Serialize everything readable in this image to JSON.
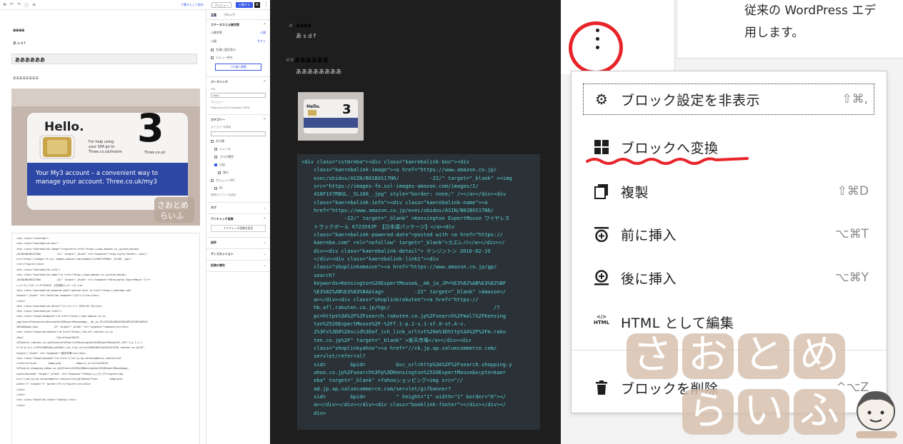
{
  "editor": {
    "topbar": {
      "draft_label": "下書きとして保存",
      "preview_label": "プレビュー",
      "publish_label": "公開する"
    },
    "content": {
      "heading": "aaaa",
      "paragraph1": "あ s d f",
      "heading2": "ああああああ",
      "paragraph2": "ああああああああ",
      "sim_card": {
        "brand": "Hello.",
        "sim_text": "For help using your SIM go to Three.co.uk/trosim",
        "site": "Three.co.uk",
        "banner": "Your My3 account – a convenient way to manage your account. Three.co.uk/my3",
        "watermark": "さおとめ らいふ"
      },
      "code_lines": [
        "<div class=\"cstmreba\">",
        "<div class=\"kaerebalink-box\">",
        "<div class=\"kaerebalink-image\"><figure><a href=\"https://www.amazon.co.jp/exec/obidos",
        "/ASIN/B01BXS17N6/          -22/\" target=\"_blank\" rel=\"noopener\"><img style=\"border: none;\"",
        "src=\"https://images-fe.ssl-images-amazon.com/images/I/418F1X7RBUL._SL160_.jpg\">",
        "</a></figure></div>",
        "<div class=\"kaerebalink-info\">",
        "<div class=\"kaerebalink-name\"><a href=\"https://www.amazon.co.jp/exec/obidos",
        "/ASIN/B01BXS17N6/          -22/\" target=\"_blank\" rel=\"noopener\">Kensington ExpertMouse ワイヤ",
        "レストラックボール K72359JP 【日本語パッケージ】</a>",
        "<div class=\"kaerebalink-powered-date\">posted with <a href=\"https://kaereba.com\"",
        "target=\"_blank\" rel=\"nofollow noopener\">カエレバ</a></div>",
        "</div>",
        "<div class=\"kaerebalink-detail\">ケンジントン 2016-02-19</div>",
        "<div class=\"kaerebalink-link1\">",
        "<div class=\"shoplinkamazon\"><a href=\"https://www.amazon.co.jp",
        "/gp/search?keywords=Kensington%20ExpertMouse&amp;__mk_ja_JP=%E3%82%AB%E3%82%BF%E3%82%AB%E3",
        "%83%8A&amp;tag=          -22\" target=\"_blank\" rel=\"noopener\">Amazon</a></div>",
        "<div class=\"shoplinkrakuten\"><a href=\"https://hb.afl.rakuten.co.jp",
        "/hgc/                      /?pc=https%3A%2F",
        "%2Fsearch.rakuten.co.jp%2Fsearch%2Fmall%2FKensington%2520ExpertMouse%2F-%2Ff.1-p.1-s.1-",
        "sf.0-st.A-v.2%3Fx%3D0%26scid%3Daf_ich_link_urltxt%26m%3Dhttp%3A%2F%2Fm.rakuten.co.jp%2F\"",
        "target=\"_blank\" rel=\"noopener\">楽天市場</a></div>",
        "<div class=\"shoplinkyahoo\"><a href=\"//ck.jp.ap.valuecommerce.com/servlet",
        "/referral?sid=        &amp;pid=          &amp;vc_url=http%3A%2F",
        "%2Fsearch.shopping.yahoo.co.jp%2Fsearch%3Fp%3DKensington%2520ExpertMouse&amp;",
        "vcptn=kaereba\" target=\"_blank\" rel=\"noopener\">Yahooショッピング<figure><img",
        "src=\"//ad.jp.ap.valuecommerce.com/servlet/gifbanner?sid=        &amp;pid=",
        "width=\"1\" height=\"1\" border=\"0\"></figure></a></div>",
        "</div>",
        "</div>",
        "<div class=\"booklink-footer\">&nbsp;</div>",
        "</div>"
      ]
    },
    "sidebar": {
      "tab_document": "文書",
      "tab_block": "ブロック",
      "status_section": "ステータスと公開状態",
      "visibility_label": "公開状態",
      "visibility_value": "公開",
      "publish_label": "公開",
      "publish_value": "今すぐ",
      "stick_label": "先頭に固定表示",
      "review_label": "レビュー待ち",
      "trash_button": "ゴミ箱へ移動",
      "permalink_section": "パーマリンク",
      "url_label": "URL",
      "url_value": "aaaa",
      "preview_label": "プレビュー",
      "preview_url": "https://jun1019.net/aaaa-7658/",
      "category_section": "カテゴリー",
      "category_search_placeholder": "カテゴリーを検索",
      "categories": [
        {
          "label": "未分類",
          "checked": false,
          "indent": 0
        },
        {
          "label": "ニュース",
          "checked": false,
          "indent": 1
        },
        {
          "label": "ブログ運営",
          "checked": false,
          "indent": 1
        },
        {
          "label": "日記",
          "checked": true,
          "indent": 1
        },
        {
          "label": "旅行",
          "checked": false,
          "indent": 2
        },
        {
          "label": "ガジェット/PC",
          "checked": false,
          "indent": 0
        },
        {
          "label": "PC",
          "checked": false,
          "indent": 1
        }
      ],
      "add_category": "新規カテゴリーを追加",
      "tag_section": "タグ",
      "eyecatch_section": "アイキャッチ画像",
      "eyecatch_button": "アイキャッチ画像を設定",
      "excerpt_section": "抜粋",
      "discussion_section": "ディスカッション",
      "attributes_section": "投稿の属性"
    }
  },
  "code_view": {
    "heading1": "aaaa",
    "para1": "あ s d f",
    "heading2": "ああああああ",
    "para2": "ああああああああ",
    "code_lines": [
      "<div class=\"cstmreba\"><div class=\"kaerebalink-box\"><div",
      "    class=\"kaerebalink-image\"><a href=\"https://www.amazon.co.jp/",
      "    exec/obidos/ASIN/B01BXS17N6/          -22/\" target=\"_blank\" ><img",
      "    src=\"https://images-fe.ssl-images-amazon.com/images/I/",
      "    418F1X7RBUL._SL160_.jpg\" style=\"border: none;\" /></a></div><div",
      "    class=\"kaerebalink-info\"><div class=\"kaerebalink-name\"><a",
      "    href=\"https://www.amazon.co.jp/exec/obidos/ASIN/B01BXS17N6/",
      "              -22/\" target=\"_blank\" >Kensington ExpertMouse ワイヤレス",
      "    トラックボール K72359JP 【日本語パッケージ】</a><div",
      "    class=\"kaerebalink-powered-date\">posted with <a href=\"https://",
      "    kaereba.com\" rel=\"nofollow\" target=\"_blank\">カエレバ</a></div></",
      "    div><div class=\"kaerebalink-detail\"> ケンジントン 2016-02-19",
      "    </div><div class=\"kaerebalink-link1\"><div",
      "    class=\"shoplinkamazon\"><a href=\"https://www.amazon.co.jp/gp/",
      "    search?",
      "    keywords=Kensington%20ExpertMouse&__mk_ja_JP=%E3%82%AB%E3%82%BF",
      "    %E3%82%AB%E3%83%8A&tag=          -22\" target=\"_blank\" >Amazon</",
      "    a></div><div class=\"shoplinkrakuten\"><a href=\"https://",
      "    hb.afl.rakuten.co.jp/hgc/                                  /?",
      "    pc=https%3A%2F%2Fsearch.rakuten.co.jp%2Fsearch%2Fmall%2FKensing",
      "    ton%2520ExpertMouse%2F-%2Ff.1-p.1-s.1-sf.0-st.A-v.",
      "    2%3Fx%3D0%26scid%3Daf_ich_link_urltxt%26m%3Dhttp%3A%2F%2Fm.raku",
      "    ten.co.jp%2F\" target=\"_blank\" >楽天市場</a></div><div",
      "    class=\"shoplinkyahoo\"><a href=\"//ck.jp.ap.valuecommerce.com/",
      "    servlet/referral?",
      "    sid=        &pid=          &vc_url=http%3A%2F%2Fsearch.shopping.y",
      "    ahoo.co.jp%2Fsearch%3Fp%3DKensington%2520ExpertMouse&vcptn=kaer",
      "    eba\" target=\"_blank\" >Yahooショッピング<img src=\"//",
      "    ad.jp.ap.valuecommerce.com/servlet/gifbanner?",
      "    sid=        &pid=          \" height=\"1\" width=\"1\" border=\"0\"></",
      "    a></div></div></div><div class=\"booklink-footer\"></div></div></",
      "    div>"
    ]
  },
  "block_menu": {
    "top_text_line1": "従来の WordPress エデ",
    "top_text_line2": "用します。",
    "items": [
      {
        "label": "ブロック設定を非表示",
        "shortcut": "⇧⌘,",
        "icon": "gear-icon"
      },
      {
        "label": "ブロックへ変換",
        "shortcut": "",
        "icon": "blocks-icon"
      },
      {
        "label": "複製",
        "shortcut": "⇧⌘D",
        "icon": "duplicate-icon"
      },
      {
        "label": "前に挿入",
        "shortcut": "⌥⌘T",
        "icon": "insert-before-icon"
      },
      {
        "label": "後に挿入",
        "shortcut": "⌥⌘Y",
        "icon": "insert-after-icon"
      },
      {
        "label": "HTML として編集",
        "shortcut": "",
        "icon": "html-icon"
      },
      {
        "label": "ブロックを削除",
        "shortcut": "^⌥Z",
        "icon": "trash-icon"
      }
    ],
    "html_icon_text": "HTML",
    "watermark": [
      "さ",
      "お",
      "と",
      "め",
      "ら",
      "い",
      "ふ"
    ],
    "colors": {
      "annotation_red": "#e8242a",
      "watermark_beige": "#d6beab"
    }
  }
}
